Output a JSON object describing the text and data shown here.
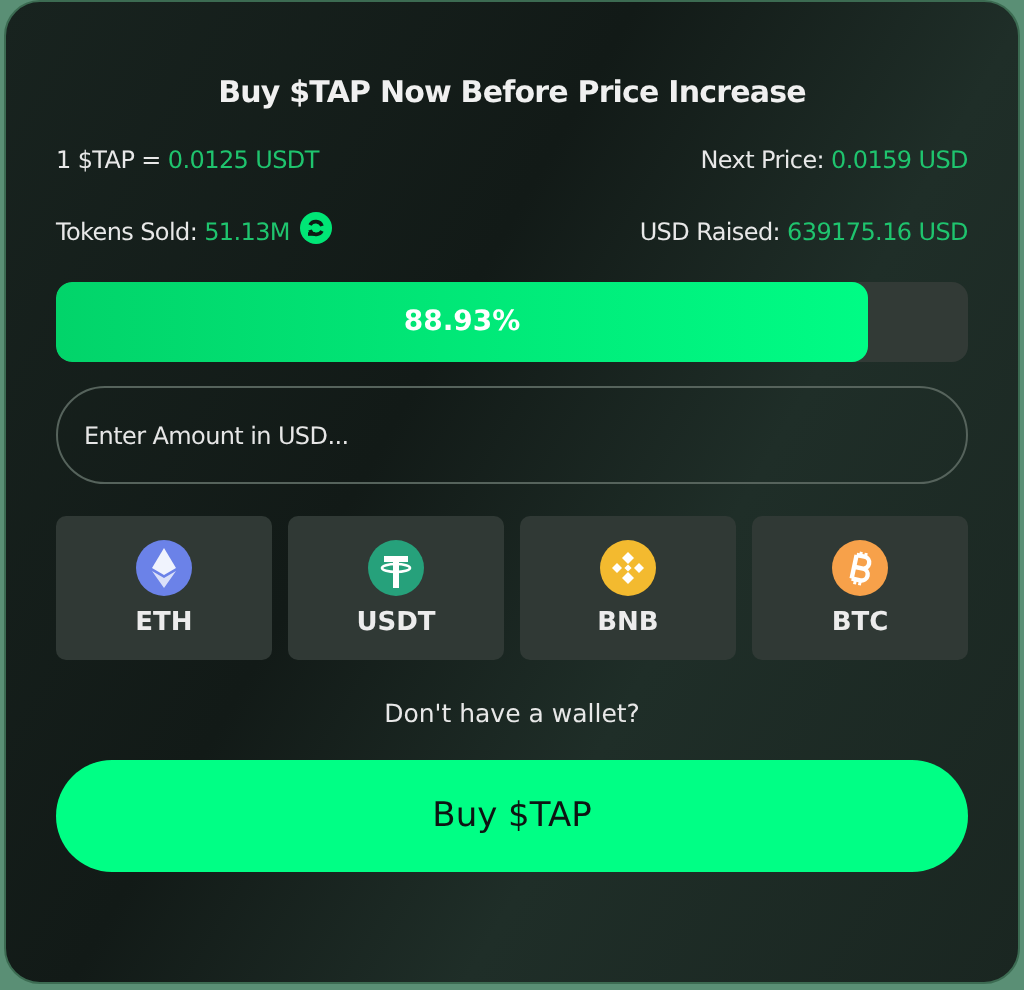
{
  "title": "Buy $TAP Now Before Price Increase",
  "stats": [
    {
      "label": "1 $TAP = ",
      "value": "0.0125 USDT"
    },
    {
      "label": "Next Price: ",
      "value": "0.0159 USD"
    },
    {
      "label": "Tokens Sold: ",
      "value": "51.13M",
      "icon": true
    },
    {
      "label": "USD Raised: ",
      "value": "639175.16 USD"
    }
  ],
  "progress": {
    "level": 0.8893,
    "label": "88.93%"
  },
  "amount": {
    "placeholder": "Enter Amount in USD..."
  },
  "currencies": [
    {
      "kind": "eth",
      "label": "ETH"
    },
    {
      "kind": "usdt",
      "label": "USDT"
    },
    {
      "kind": "bnb",
      "label": "BNB"
    },
    {
      "kind": "btc",
      "label": "BTC"
    }
  ],
  "wallet_link": "Don't have a wallet?",
  "buy_button": "Buy $TAP"
}
